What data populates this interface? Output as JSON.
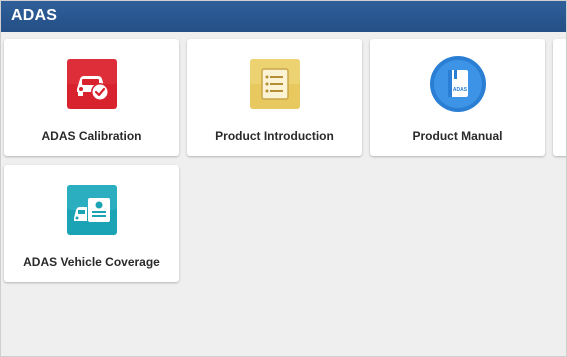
{
  "header": {
    "title": "ADAS"
  },
  "tiles": [
    {
      "label": "ADAS Calibration",
      "icon": "car-check-icon",
      "color": "#d8232f"
    },
    {
      "label": "Product Introduction",
      "icon": "list-document-icon",
      "color": "#e7c95f"
    },
    {
      "label": "Product Manual",
      "icon": "manual-book-icon",
      "color": "#2a7fd4",
      "icon_text": "ADAS"
    },
    {
      "label": "ADAS Vehicle Coverage",
      "icon": "car-id-card-icon",
      "color": "#1aa3b5"
    }
  ]
}
